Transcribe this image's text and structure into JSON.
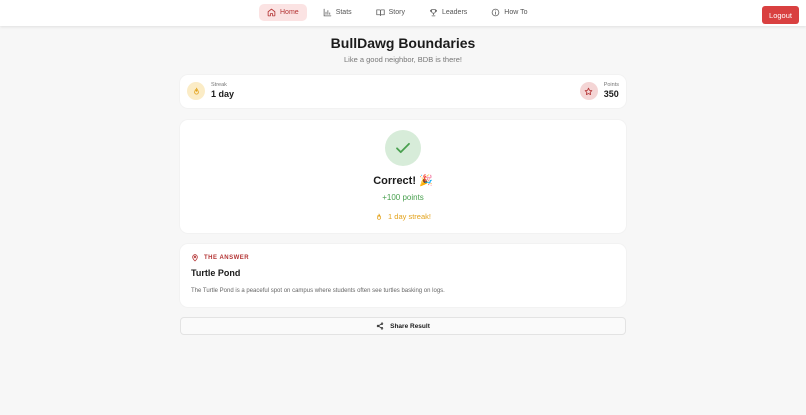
{
  "nav": {
    "items": [
      {
        "label": "Home",
        "icon": "home-icon",
        "active": true
      },
      {
        "label": "Stats",
        "icon": "bar-chart-icon"
      },
      {
        "label": "Story",
        "icon": "book-icon"
      },
      {
        "label": "Leaders",
        "icon": "trophy-icon"
      },
      {
        "label": "How To",
        "icon": "info-icon"
      }
    ],
    "logout_label": "Logout"
  },
  "header": {
    "title": "BullDawg Boundaries",
    "subtitle": "Like a good neighbor, BDB is there!"
  },
  "stats": {
    "streak_label": "Streak",
    "streak_value": "1 day",
    "points_label": "Points",
    "points_value": "350"
  },
  "result": {
    "heading": "Correct! 🎉",
    "points_earned": "+100 points",
    "streak_text": "1 day streak!"
  },
  "answer": {
    "label": "THE ANSWER",
    "name": "Turtle Pond",
    "description": "The Turtle Pond is a peaceful spot on campus where students often see turtles basking on logs."
  },
  "share": {
    "label": "Share Result"
  },
  "colors": {
    "accent": "#d94040",
    "success": "#49a04f",
    "streak": "#e3a21a"
  }
}
